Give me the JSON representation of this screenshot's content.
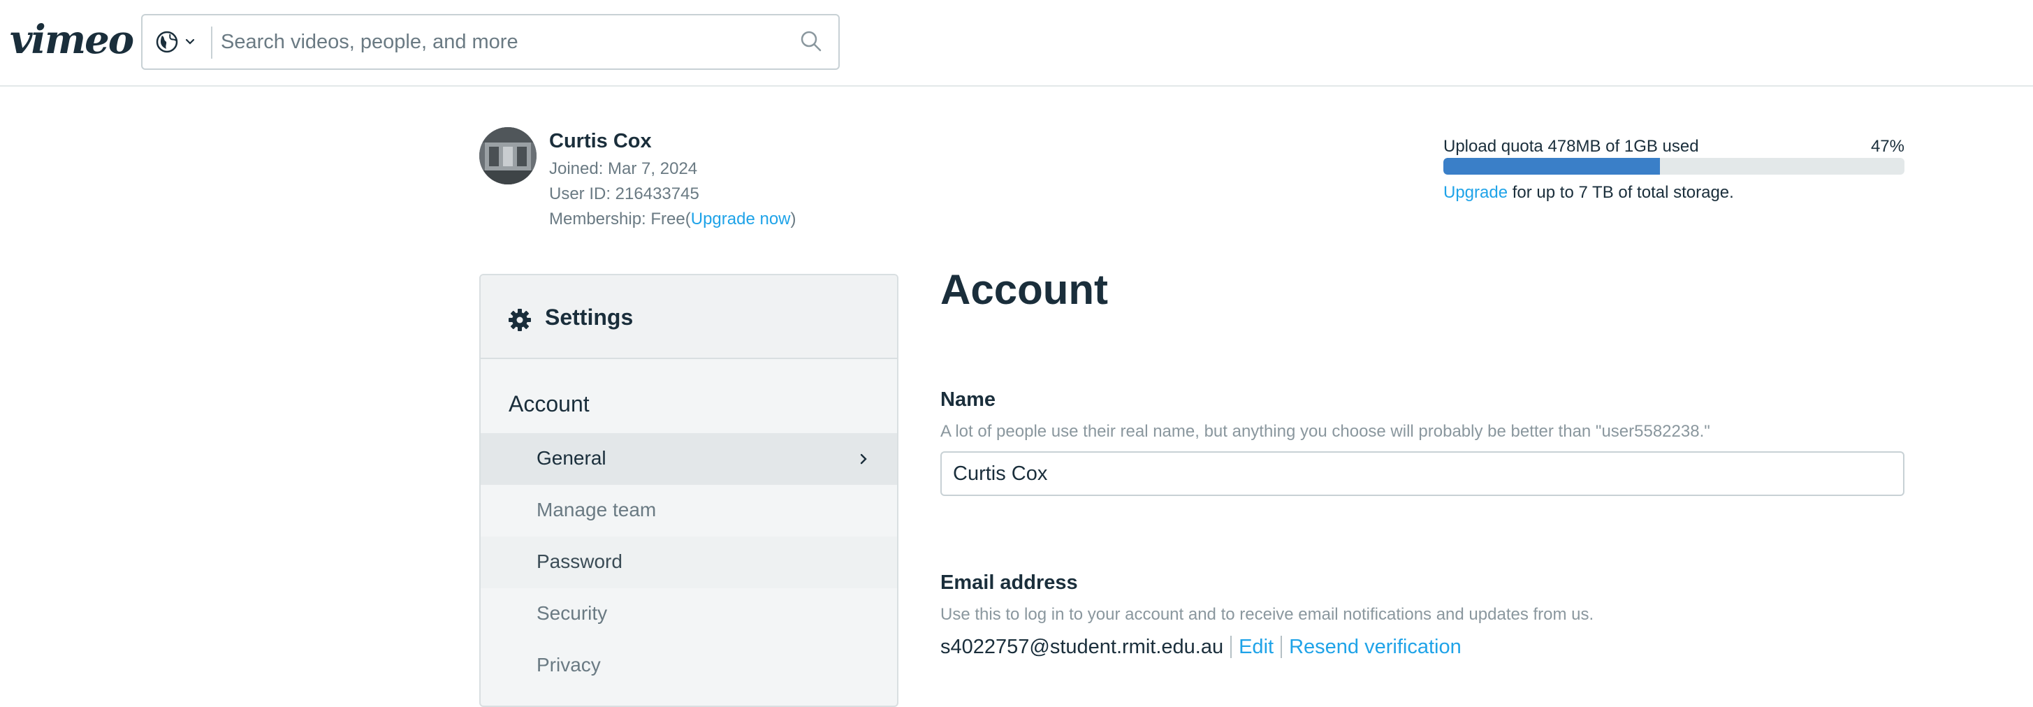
{
  "brand": {
    "logo_text": "vimeo"
  },
  "search": {
    "placeholder": "Search videos, people, and more"
  },
  "profile": {
    "name": "Curtis Cox",
    "joined": "Joined: Mar 7, 2024",
    "user_id": "User ID: 216433745",
    "membership_prefix": "Membership: Free(",
    "membership_link": "Upgrade now",
    "membership_suffix": ")"
  },
  "quota": {
    "label": "Upload quota 478MB of 1GB used",
    "percent_text": "47%",
    "percent_value": 47,
    "upgrade_link": "Upgrade",
    "note": "for up to 7 TB of total storage."
  },
  "sidebar": {
    "title": "Settings",
    "section": "Account",
    "items": [
      {
        "label": "General",
        "active": true
      },
      {
        "label": "Manage team",
        "active": false
      },
      {
        "label": "Password",
        "active": false
      },
      {
        "label": "Security",
        "active": false
      },
      {
        "label": "Privacy",
        "active": false
      }
    ]
  },
  "main": {
    "title": "Account",
    "name_field": {
      "label": "Name",
      "help": "A lot of people use their real name, but anything you choose will probably be better than \"user5582238.\"",
      "value": "Curtis Cox"
    },
    "email_field": {
      "label": "Email address",
      "help": "Use this to log in to your account and to receive email notifications and updates from us.",
      "value": "s4022757@student.rmit.edu.au",
      "edit_link": "Edit",
      "resend_link": "Resend verification"
    }
  },
  "colors": {
    "text": "#1a2e3b",
    "muted": "#6a7a83",
    "link": "#1fa3e8",
    "progress": "#3a7fc8"
  }
}
